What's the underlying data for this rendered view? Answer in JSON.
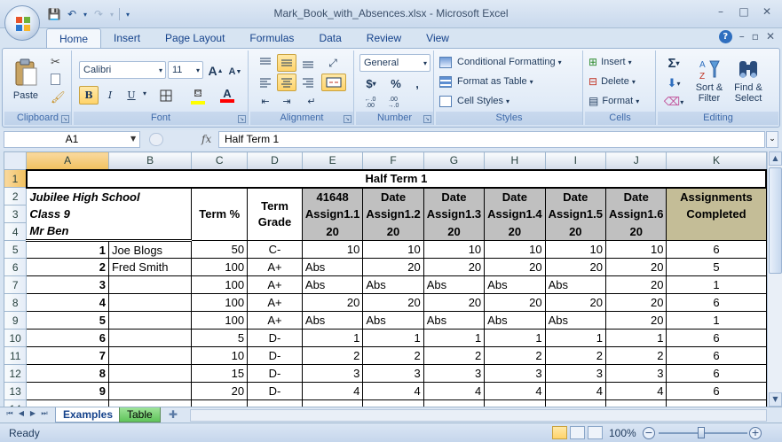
{
  "window": {
    "title": "Mark_Book_with_Absences.xlsx - Microsoft Excel",
    "controls": [
      "–",
      "□",
      "✕"
    ]
  },
  "qat": {
    "save": "💾",
    "undo": "↶",
    "undo_arrow": "▾",
    "redo": "↷",
    "redo_arrow": "▾",
    "customize": "▾"
  },
  "ribbon": {
    "tabs": [
      "Home",
      "Insert",
      "Page Layout",
      "Formulas",
      "Data",
      "Review",
      "View"
    ],
    "active_tab": "Home",
    "groups": {
      "clipboard": {
        "label": "Clipboard",
        "paste": "Paste"
      },
      "font": {
        "label": "Font",
        "name": "Calibri",
        "size": "11",
        "grow": "A",
        "shrink": "A",
        "bold": "B",
        "italic": "I",
        "underline": "U",
        "font_color_letter": "A"
      },
      "alignment": {
        "label": "Alignment"
      },
      "number": {
        "label": "Number",
        "format": "General",
        "currency": "$",
        "percent": "%",
        "comma": ",",
        "inc_decimal": "←.0\n.00",
        "dec_decimal": ".00\n→.0"
      },
      "styles": {
        "label": "Styles",
        "conditional": "Conditional Formatting",
        "format_table": "Format as Table",
        "cell_styles": "Cell Styles"
      },
      "cells": {
        "label": "Cells",
        "insert": "Insert",
        "delete": "Delete",
        "format": "Format"
      },
      "editing": {
        "label": "Editing",
        "sum": "Σ",
        "sort_filter_1": "Sort &",
        "sort_filter_2": "Filter",
        "find_select_1": "Find &",
        "find_select_2": "Select"
      }
    }
  },
  "formula_bar": {
    "name_box": "A1",
    "fx": "fx",
    "content": "Half Term 1"
  },
  "sheet": {
    "columns": [
      "A",
      "B",
      "C",
      "D",
      "E",
      "F",
      "G",
      "H",
      "I",
      "J",
      "K"
    ],
    "rows": [
      "1",
      "2",
      "3",
      "4",
      "5",
      "6",
      "7",
      "8",
      "9",
      "10",
      "11",
      "12",
      "13",
      "14"
    ],
    "title": "Half Term 1",
    "school": "Jubilee High School",
    "class": "Class 9",
    "teacher": "Mr Ben",
    "term_pct": "Term %",
    "term_grade_1": "Term",
    "term_grade_2": "Grade",
    "assignments": [
      {
        "top": "41648",
        "name": "Assign1.1",
        "max": "20"
      },
      {
        "top": "Date",
        "name": "Assign1.2",
        "max": "20"
      },
      {
        "top": "Date",
        "name": "Assign1.3",
        "max": "20"
      },
      {
        "top": "Date",
        "name": "Assign1.4",
        "max": "20"
      },
      {
        "top": "Date",
        "name": "Assign1.5",
        "max": "20"
      },
      {
        "top": "Date",
        "name": "Assign1.6",
        "max": "20"
      }
    ],
    "completed_1": "Assignments",
    "completed_2": "Completed",
    "students": [
      {
        "no": "1",
        "name": "Joe Blogs",
        "pct": "50",
        "grade": "C-",
        "scores": [
          "10",
          "10",
          "10",
          "10",
          "10",
          "10"
        ],
        "done": "6"
      },
      {
        "no": "2",
        "name": "Fred Smith",
        "pct": "100",
        "grade": "A+",
        "scores": [
          "Abs",
          "20",
          "20",
          "20",
          "20",
          "20"
        ],
        "done": "5"
      },
      {
        "no": "3",
        "name": "",
        "pct": "100",
        "grade": "A+",
        "scores": [
          "Abs",
          "Abs",
          "Abs",
          "Abs",
          "Abs",
          "20"
        ],
        "done": "1"
      },
      {
        "no": "4",
        "name": "",
        "pct": "100",
        "grade": "A+",
        "scores": [
          "20",
          "20",
          "20",
          "20",
          "20",
          "20"
        ],
        "done": "6"
      },
      {
        "no": "5",
        "name": "",
        "pct": "100",
        "grade": "A+",
        "scores": [
          "Abs",
          "Abs",
          "Abs",
          "Abs",
          "Abs",
          "20"
        ],
        "done": "1"
      },
      {
        "no": "6",
        "name": "",
        "pct": "5",
        "grade": "D-",
        "scores": [
          "1",
          "1",
          "1",
          "1",
          "1",
          "1"
        ],
        "done": "6"
      },
      {
        "no": "7",
        "name": "",
        "pct": "10",
        "grade": "D-",
        "scores": [
          "2",
          "2",
          "2",
          "2",
          "2",
          "2"
        ],
        "done": "6"
      },
      {
        "no": "8",
        "name": "",
        "pct": "15",
        "grade": "D-",
        "scores": [
          "3",
          "3",
          "3",
          "3",
          "3",
          "3"
        ],
        "done": "6"
      },
      {
        "no": "9",
        "name": "",
        "pct": "20",
        "grade": "D-",
        "scores": [
          "4",
          "4",
          "4",
          "4",
          "4",
          "4"
        ],
        "done": "6"
      }
    ]
  },
  "sheet_tabs": [
    "Examples",
    "Table"
  ],
  "active_sheet": "Examples",
  "status": {
    "text": "Ready",
    "zoom": "100%",
    "zoom_minus": "−",
    "zoom_plus": "+"
  }
}
